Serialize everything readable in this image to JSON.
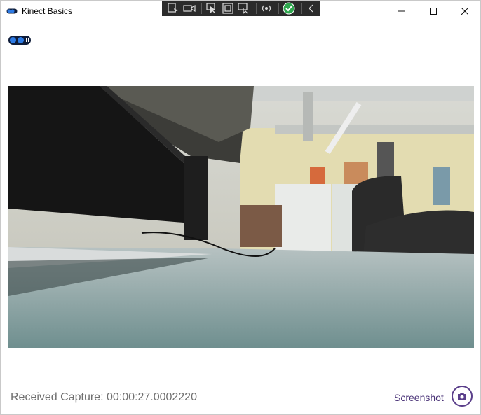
{
  "window": {
    "title": "Kinect Basics"
  },
  "window_controls": {
    "minimize": "—",
    "maximize": "☐",
    "close": "✕"
  },
  "debug_toolbar": {
    "tools": [
      "select-element-icon",
      "record-icon",
      "pointer-icon",
      "frame-icon",
      "refresh-icon",
      "live-icon",
      "check-icon",
      "collapse-icon"
    ]
  },
  "status": {
    "text": "Received Capture: 00:00:27.0002220"
  },
  "screenshot": {
    "label": "Screenshot"
  },
  "colors": {
    "accent": "#5a3e8a",
    "status_text": "#707070",
    "toggle_bg": "#0f1d3a",
    "toggle_dot": "#2d7be5"
  }
}
